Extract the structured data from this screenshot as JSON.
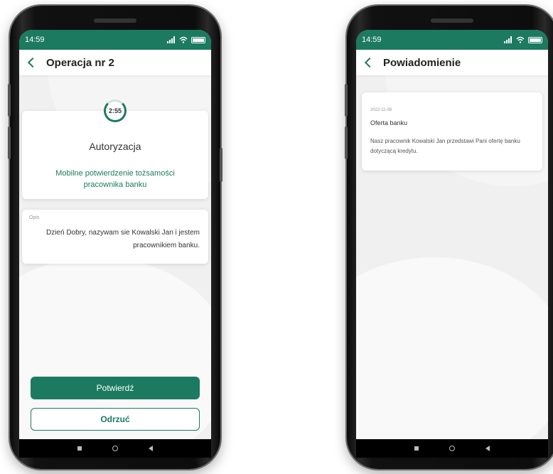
{
  "colors": {
    "brand": "#1b7a5f",
    "background": "#f0f0f0"
  },
  "phone_left": {
    "status": {
      "time": "14:59"
    },
    "header": {
      "title": "Operacja nr 2"
    },
    "timer": "2:55",
    "auth_card": {
      "title": "Autoryzacja",
      "subtitle": "Mobilne potwierdzenie tożsamości pracownika banku"
    },
    "desc_card": {
      "label": "Opis",
      "text": "Dzień Dobry, nazywam sie Kowalski Jan i jestem pracownikiem banku."
    },
    "buttons": {
      "confirm": "Potwierdź",
      "reject": "Odrzuć"
    }
  },
  "phone_right": {
    "status": {
      "time": "14:59"
    },
    "header": {
      "title": "Powiadomienie"
    },
    "notification": {
      "date": "2022-11-08",
      "title": "Oferta banku",
      "body": "Nasz pracownik Kowalski Jan przedstawi Pani ofertę banku dotyczącą kredytu."
    }
  }
}
